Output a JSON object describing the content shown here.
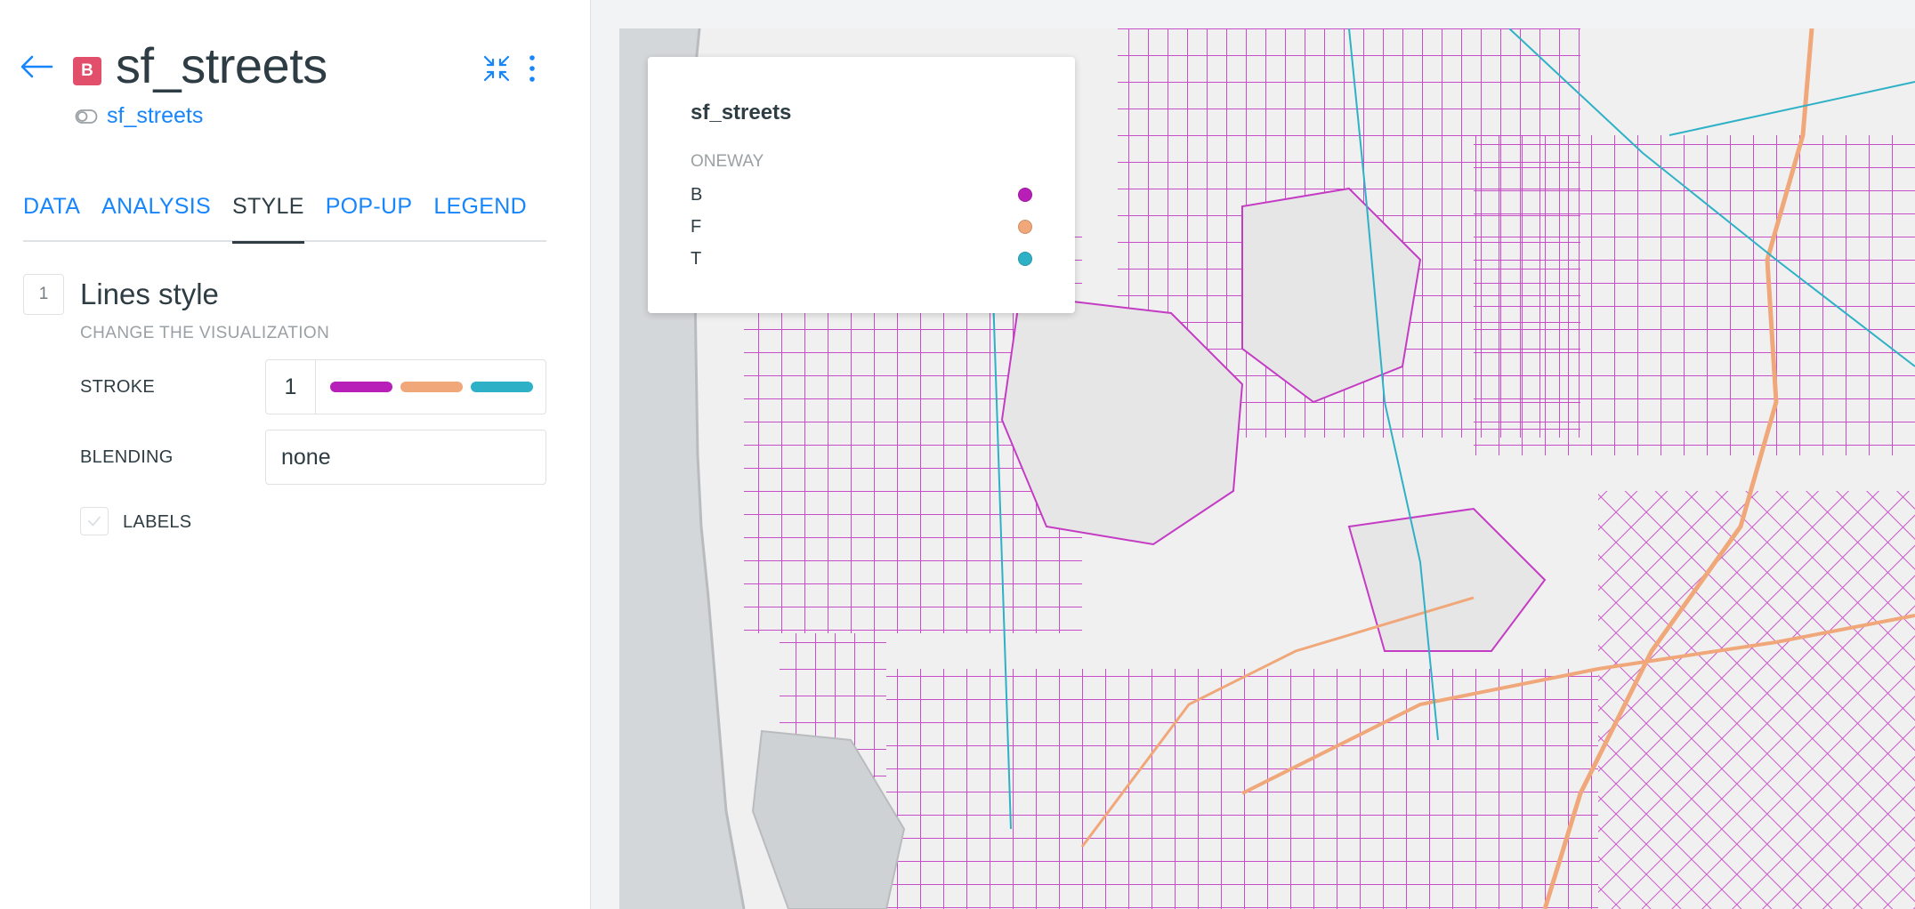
{
  "layer": {
    "badge_letter": "B",
    "badge_color": "#e14f6a",
    "title": "sf_streets",
    "source_name": "sf_streets"
  },
  "tabs": [
    {
      "label": "DATA",
      "active": false
    },
    {
      "label": "ANALYSIS",
      "active": false
    },
    {
      "label": "STYLE",
      "active": true
    },
    {
      "label": "POP-UP",
      "active": false
    },
    {
      "label": "LEGEND",
      "active": false
    }
  ],
  "style": {
    "step_number": "1",
    "title": "Lines style",
    "subtitle": "CHANGE THE VISUALIZATION",
    "stroke_label": "STROKE",
    "stroke_width": "1",
    "stroke_ramp": [
      "#b81fb8",
      "#f0a779",
      "#2eb1c6"
    ],
    "blending_label": "BLENDING",
    "blending_value": "none",
    "labels_label": "LABELS",
    "labels_checked": false
  },
  "legend": {
    "title": "sf_streets",
    "attribute": "ONEWAY",
    "items": [
      {
        "label": "B",
        "color": "#b81fb8"
      },
      {
        "label": "F",
        "color": "#f0a779"
      },
      {
        "label": "T",
        "color": "#2eb1c6"
      }
    ]
  },
  "icons": {
    "back": "arrow-left-icon",
    "compress": "compress-icon",
    "more": "more-vertical-icon",
    "source": "toggle-icon",
    "check": "check-icon"
  },
  "colors": {
    "accent": "#1785fb",
    "text": "#2e3c43",
    "water": "#d4d7d9",
    "land": "#f0f0f0"
  }
}
